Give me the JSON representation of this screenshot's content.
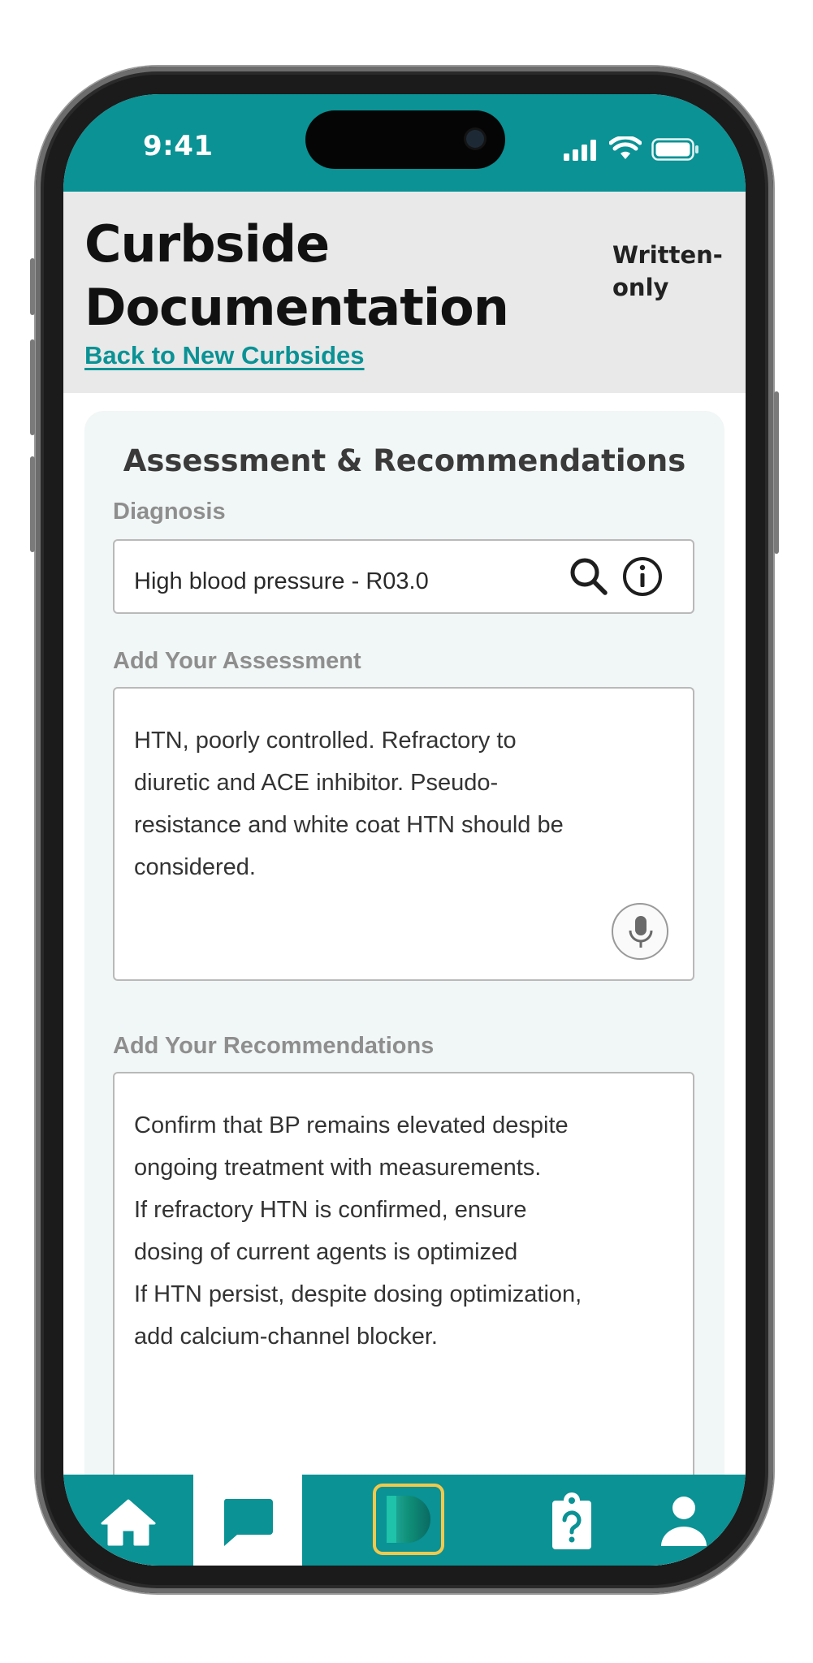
{
  "status_bar": {
    "time": "9:41"
  },
  "header": {
    "title_line1": "Curbside",
    "title_line2": "Documentation",
    "mode_line1": "Written-",
    "mode_line2": "only",
    "back_link": "Back to New Curbsides"
  },
  "card": {
    "title": "Assessment & Recommendations",
    "diagnosis": {
      "label": "Diagnosis",
      "value": "High blood pressure - R03.0",
      "icons": [
        "search-icon",
        "info-icon"
      ]
    },
    "assessment": {
      "label": "Add Your Assessment",
      "lines": [
        "HTN, poorly controlled. Refractory to",
        "diuretic and ACE inhibitor. Pseudo-",
        "resistance and white coat HTN should be",
        "considered."
      ],
      "icon": "microphone-icon"
    },
    "recommendations": {
      "label": "Add Your Recommendations",
      "lines": [
        "Confirm that BP remains elevated despite",
        "ongoing treatment with measurements.",
        "If refractory HTN is confirmed, ensure",
        "dosing of current agents is optimized",
        "If HTN persist, despite dosing optimization,",
        "add calcium-channel blocker."
      ]
    }
  },
  "tab_bar": {
    "tabs": [
      {
        "name": "home",
        "icon": "home-icon",
        "active": false
      },
      {
        "name": "curbsides",
        "icon": "chat-bubble-icon",
        "active": true
      },
      {
        "name": "app-logo",
        "icon": "app-logo-icon",
        "active": false
      },
      {
        "name": "questions",
        "icon": "clipboard-question-icon",
        "active": false
      },
      {
        "name": "profile",
        "icon": "person-icon",
        "active": false
      }
    ]
  },
  "colors": {
    "brand_teal": "#0a9295",
    "header_bg": "#e9e9e9",
    "card_bg": "#f1f6f6",
    "logo_border": "#f2c94c"
  }
}
